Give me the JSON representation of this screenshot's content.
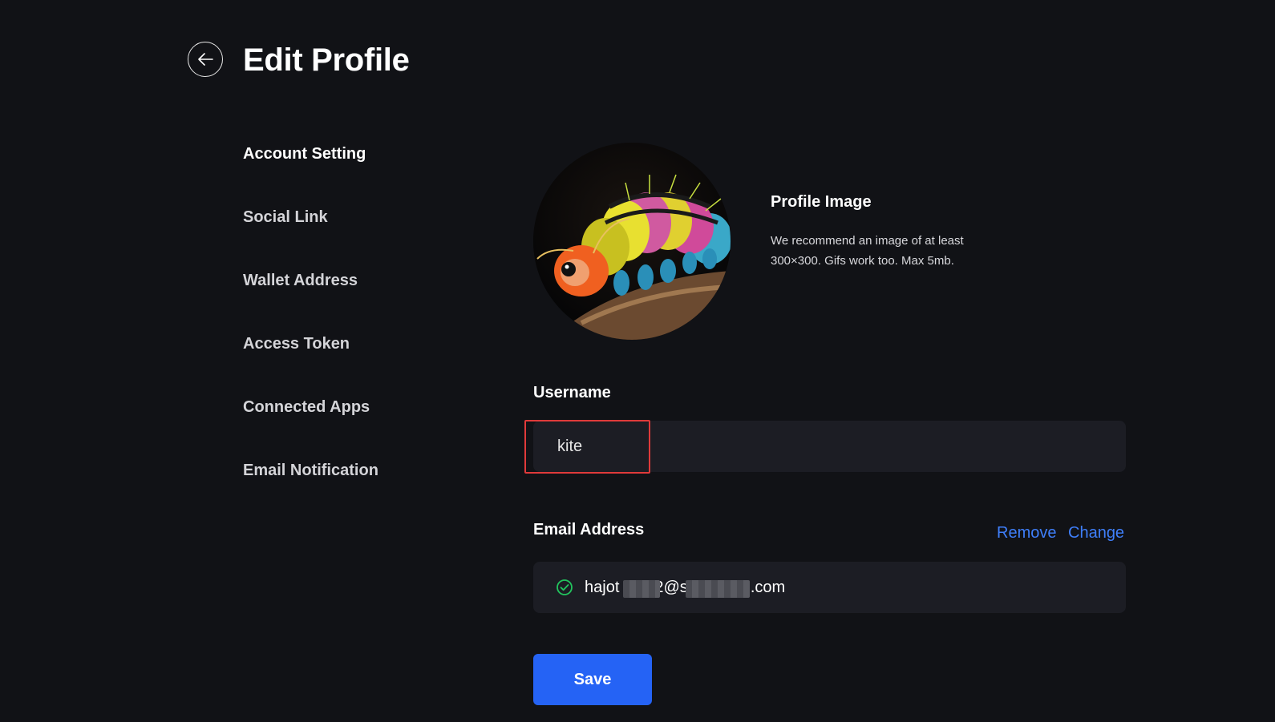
{
  "header": {
    "title": "Edit Profile"
  },
  "sidebar": {
    "items": [
      {
        "label": "Account Setting"
      },
      {
        "label": "Social Link"
      },
      {
        "label": "Wallet Address"
      },
      {
        "label": "Access Token"
      },
      {
        "label": "Connected Apps"
      },
      {
        "label": "Email Notification"
      }
    ]
  },
  "profile_image": {
    "title": "Profile Image",
    "description": "We recommend an image of at least 300×300. Gifs work too. Max 5mb."
  },
  "username": {
    "label": "Username",
    "value": "kite"
  },
  "email": {
    "label": "Email Address",
    "remove_label": "Remove",
    "change_label": "Change",
    "value_prefix": "hajot",
    "value_mid": "2@s",
    "value_suffix": ".com"
  },
  "actions": {
    "save_label": "Save"
  },
  "colors": {
    "accent": "#2563f5",
    "link": "#3f7ffa",
    "verified": "#22c55e",
    "highlight": "#e03a3a"
  }
}
